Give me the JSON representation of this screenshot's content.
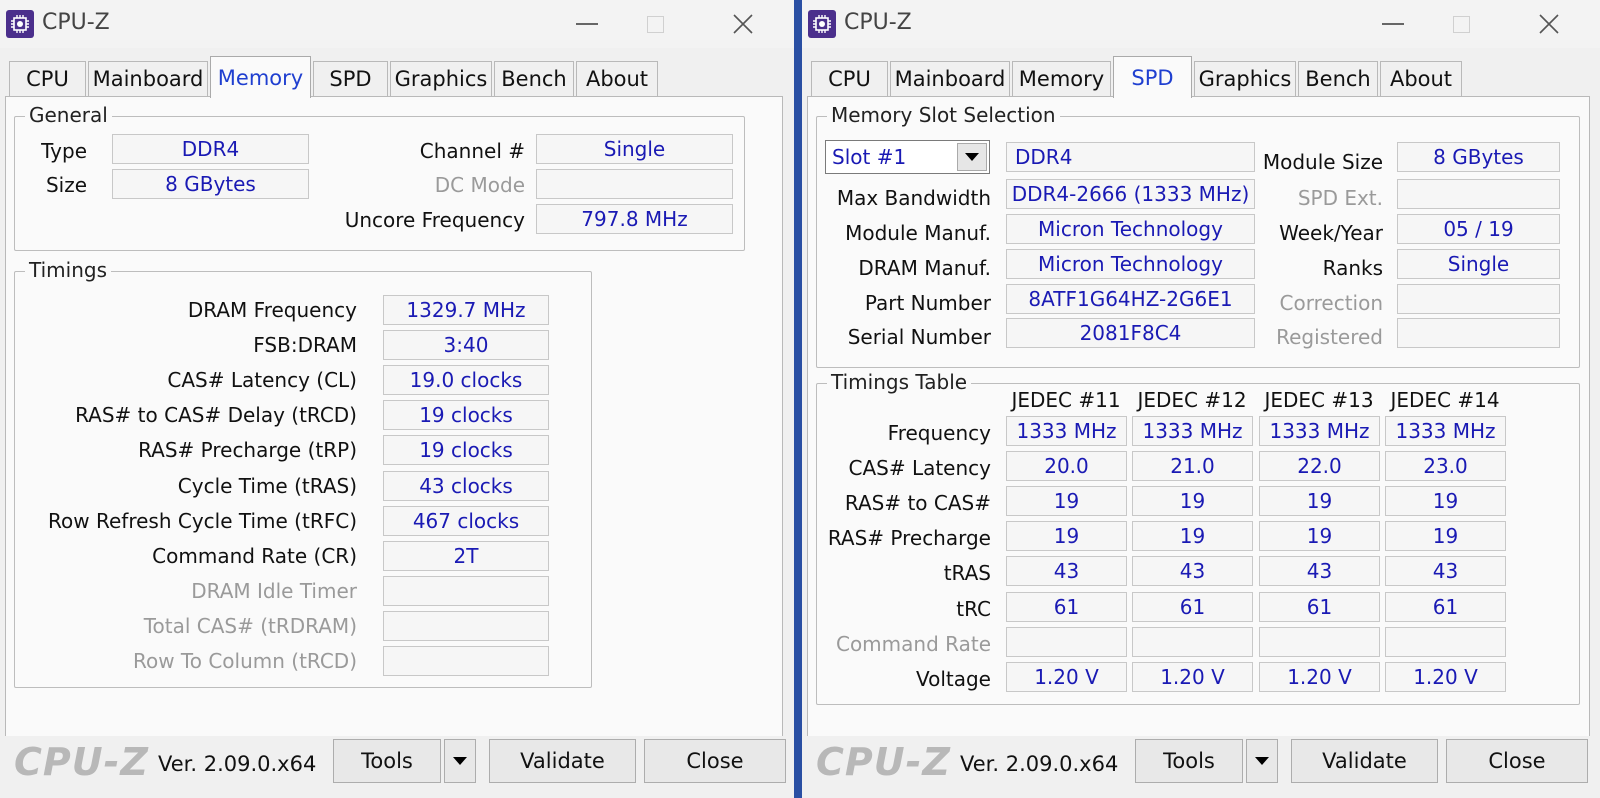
{
  "window": {
    "title": "CPU-Z",
    "tabs": [
      "CPU",
      "Mainboard",
      "Memory",
      "SPD",
      "Graphics",
      "Bench",
      "About"
    ],
    "logo": "CPU-Z",
    "version": "Ver. 2.09.0.x64",
    "tools_label": "Tools",
    "validate_label": "Validate",
    "close_label": "Close"
  },
  "memory": {
    "active_tab": "Memory",
    "general": {
      "title": "General",
      "type_label": "Type",
      "type_value": "DDR4",
      "size_label": "Size",
      "size_value": "8 GBytes",
      "channel_label": "Channel #",
      "channel_value": "Single",
      "dcmode_label": "DC Mode",
      "dcmode_value": "",
      "uncore_label": "Uncore Frequency",
      "uncore_value": "797.8 MHz"
    },
    "timings": {
      "title": "Timings",
      "rows": [
        {
          "label": "DRAM Frequency",
          "value": "1329.7 MHz",
          "enabled": true
        },
        {
          "label": "FSB:DRAM",
          "value": "3:40",
          "enabled": true
        },
        {
          "label": "CAS# Latency (CL)",
          "value": "19.0 clocks",
          "enabled": true
        },
        {
          "label": "RAS# to CAS# Delay (tRCD)",
          "value": "19 clocks",
          "enabled": true
        },
        {
          "label": "RAS# Precharge (tRP)",
          "value": "19 clocks",
          "enabled": true
        },
        {
          "label": "Cycle Time (tRAS)",
          "value": "43 clocks",
          "enabled": true
        },
        {
          "label": "Row Refresh Cycle Time (tRFC)",
          "value": "467 clocks",
          "enabled": true
        },
        {
          "label": "Command Rate (CR)",
          "value": "2T",
          "enabled": true
        },
        {
          "label": "DRAM Idle Timer",
          "value": "",
          "enabled": false
        },
        {
          "label": "Total CAS# (tRDRAM)",
          "value": "",
          "enabled": false
        },
        {
          "label": "Row To Column (tRCD)",
          "value": "",
          "enabled": false
        }
      ]
    }
  },
  "spd": {
    "active_tab": "SPD",
    "slot": {
      "title": "Memory Slot Selection",
      "selected_slot": "Slot #1",
      "type_value": "DDR4",
      "module_size_label": "Module Size",
      "module_size_value": "8 GBytes",
      "max_bw_label": "Max Bandwidth",
      "max_bw_value": "DDR4-2666 (1333 MHz)",
      "spd_ext_label": "SPD Ext.",
      "spd_ext_value": "",
      "module_manuf_label": "Module Manuf.",
      "module_manuf_value": "Micron Technology",
      "week_year_label": "Week/Year",
      "week_year_value": "05 / 19",
      "dram_manuf_label": "DRAM Manuf.",
      "dram_manuf_value": "Micron Technology",
      "ranks_label": "Ranks",
      "ranks_value": "Single",
      "part_label": "Part Number",
      "part_value": "8ATF1G64HZ-2G6E1",
      "correction_label": "Correction",
      "correction_value": "",
      "serial_label": "Serial Number",
      "serial_value": "2081F8C4",
      "registered_label": "Registered",
      "registered_value": ""
    },
    "timings_table": {
      "title": "Timings Table",
      "columns": [
        "JEDEC #11",
        "JEDEC #12",
        "JEDEC #13",
        "JEDEC #14"
      ],
      "rows": [
        {
          "label": "Frequency",
          "enabled": true,
          "values": [
            "1333 MHz",
            "1333 MHz",
            "1333 MHz",
            "1333 MHz"
          ]
        },
        {
          "label": "CAS# Latency",
          "enabled": true,
          "values": [
            "20.0",
            "21.0",
            "22.0",
            "23.0"
          ]
        },
        {
          "label": "RAS# to CAS#",
          "enabled": true,
          "values": [
            "19",
            "19",
            "19",
            "19"
          ]
        },
        {
          "label": "RAS# Precharge",
          "enabled": true,
          "values": [
            "19",
            "19",
            "19",
            "19"
          ]
        },
        {
          "label": "tRAS",
          "enabled": true,
          "values": [
            "43",
            "43",
            "43",
            "43"
          ]
        },
        {
          "label": "tRC",
          "enabled": true,
          "values": [
            "61",
            "61",
            "61",
            "61"
          ]
        },
        {
          "label": "Command Rate",
          "enabled": false,
          "values": [
            "",
            "",
            "",
            ""
          ]
        },
        {
          "label": "Voltage",
          "enabled": true,
          "values": [
            "1.20 V",
            "1.20 V",
            "1.20 V",
            "1.20 V"
          ]
        }
      ]
    }
  }
}
